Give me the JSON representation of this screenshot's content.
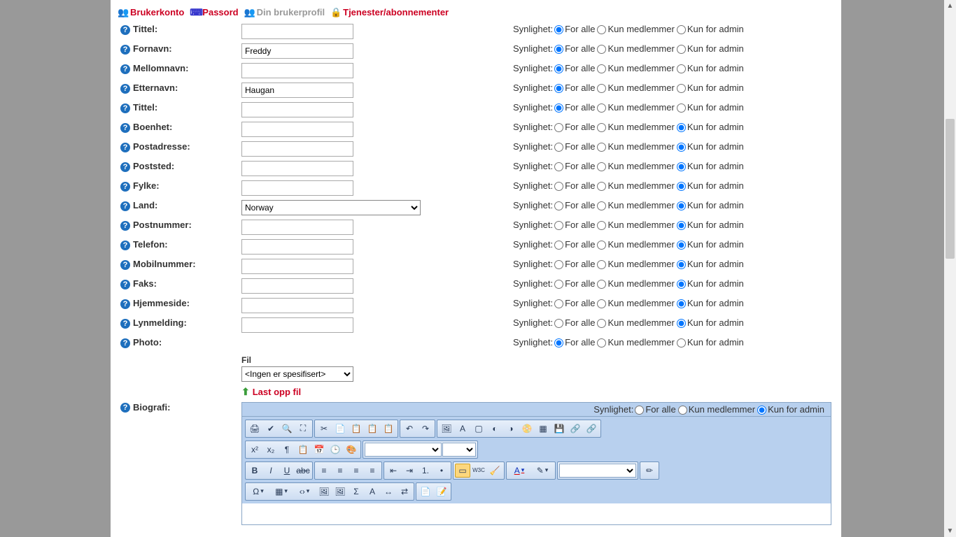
{
  "tabs": [
    {
      "label": "Brukerkonto",
      "active": true,
      "icon": "users"
    },
    {
      "label": "Passord",
      "active": true,
      "icon": "pass"
    },
    {
      "label": "Din brukerprofil",
      "active": false,
      "icon": "users"
    },
    {
      "label": "Tjenester/abonnementer",
      "active": true,
      "icon": "lock"
    }
  ],
  "visibility": {
    "label": "Synlighet:",
    "options": [
      "For alle",
      "Kun medlemmer",
      "Kun for admin"
    ]
  },
  "fields": [
    {
      "key": "tittel",
      "label": "Tittel:",
      "value": "",
      "type": "text",
      "vsel": 0
    },
    {
      "key": "fornavn",
      "label": "Fornavn:",
      "value": "Freddy",
      "type": "text",
      "vsel": 0
    },
    {
      "key": "mellomnavn",
      "label": "Mellomnavn:",
      "value": "",
      "type": "text",
      "vsel": 0
    },
    {
      "key": "etternavn",
      "label": "Etternavn:",
      "value": "Haugan",
      "type": "text",
      "vsel": 0
    },
    {
      "key": "tittel2",
      "label": "Tittel:",
      "value": "",
      "type": "text",
      "vsel": 0
    },
    {
      "key": "boenhet",
      "label": "Boenhet:",
      "value": "",
      "type": "text",
      "vsel": 2
    },
    {
      "key": "postadresse",
      "label": "Postadresse:",
      "value": "",
      "type": "text",
      "vsel": 2
    },
    {
      "key": "poststed",
      "label": "Poststed:",
      "value": "",
      "type": "text",
      "vsel": 2
    },
    {
      "key": "fylke",
      "label": "Fylke:",
      "value": "",
      "type": "text",
      "vsel": 2
    },
    {
      "key": "land",
      "label": "Land:",
      "value": "Norway",
      "type": "select",
      "vsel": 2
    },
    {
      "key": "postnummer",
      "label": "Postnummer:",
      "value": "",
      "type": "text",
      "vsel": 2
    },
    {
      "key": "telefon",
      "label": "Telefon:",
      "value": "",
      "type": "text",
      "vsel": 2
    },
    {
      "key": "mobilnummer",
      "label": "Mobilnummer:",
      "value": "",
      "type": "text",
      "vsel": 2
    },
    {
      "key": "faks",
      "label": "Faks:",
      "value": "",
      "type": "text",
      "vsel": 2
    },
    {
      "key": "hjemmeside",
      "label": "Hjemmeside:",
      "value": "",
      "type": "text",
      "vsel": 2
    },
    {
      "key": "lynmelding",
      "label": "Lynmelding:",
      "value": "",
      "type": "text",
      "vsel": 2
    },
    {
      "key": "photo",
      "label": "Photo:",
      "value": "",
      "type": "photo",
      "vsel": 0
    }
  ],
  "photo": {
    "fil_label": "Fil",
    "select_value": "<Ingen er spesifisert>",
    "upload_label": "Last opp fil"
  },
  "biografiRow": {
    "label": "Biografi:",
    "vsel": 2
  },
  "rte": {
    "row1": [
      [
        "print",
        "spell",
        "find",
        "fullscreen"
      ],
      [
        "cut",
        "copy",
        "paste",
        "paste-text",
        "paste-word"
      ],
      [
        "undo",
        "redo"
      ],
      [
        "image",
        "image-map",
        "char",
        "media1",
        "media2",
        "media3",
        "table-img",
        "anchor",
        "link",
        "unlink"
      ]
    ],
    "row2": [
      [
        "sup",
        "sub",
        "showblocks",
        "blockquote",
        "date",
        "time",
        "img-btn"
      ],
      [
        "select-font",
        "select-size"
      ]
    ],
    "row3": [
      [
        "bold",
        "italic",
        "underline",
        "strike"
      ],
      [
        "align-l",
        "align-c",
        "align-r",
        "align-j"
      ],
      [
        "outdent",
        "indent",
        "ol",
        "ul"
      ],
      [
        "div",
        "w3c",
        "clear"
      ],
      [
        "fontcolor",
        "bgcolor"
      ],
      [
        "select-style"
      ],
      [
        "highlight"
      ]
    ],
    "row4": [
      [
        "omega",
        "table",
        "brackets",
        "img-a",
        "img-b",
        "sigma",
        "find-a",
        "spacer",
        "replace"
      ],
      [
        "page",
        "page-ed"
      ]
    ],
    "glyphs": {
      "print": "🖨",
      "spell": "✔",
      "find": "🔍",
      "fullscreen": "⛶",
      "cut": "✂",
      "copy": "📄",
      "paste": "📋",
      "paste-text": "📋",
      "paste-word": "📋",
      "undo": "↶",
      "redo": "↷",
      "image": "🖼",
      "image-map": "A",
      "char": "▢",
      "media1": "◐",
      "media2": "◑",
      "media3": "📀",
      "table-img": "▦",
      "anchor": "💾",
      "link": "🔗",
      "unlink": "🔗",
      "sup": "x²",
      "sub": "x₂",
      "showblocks": "¶",
      "blockquote": "📋",
      "date": "📅",
      "time": "🕒",
      "img-btn": "🎨",
      "bold": "B",
      "italic": "I",
      "underline": "U",
      "strike": "abc",
      "align-l": "≡",
      "align-c": "≡",
      "align-r": "≡",
      "align-j": "≡",
      "outdent": "⇤",
      "indent": "⇥",
      "ol": "1.",
      "ul": "•",
      "div": "▭",
      "w3c": "W3C",
      "clear": "🧹",
      "fontcolor": "A",
      "bgcolor": "✎",
      "highlight": "✏",
      "omega": "Ω",
      "table": "▦",
      "brackets": "‹›",
      "img-a": "🖼",
      "img-b": "🖼",
      "sigma": "Σ",
      "find-a": "A",
      "spacer": "↔",
      "replace": "⇄",
      "page": "📄",
      "page-ed": "📝"
    },
    "dropdown_keys": [
      "table",
      "brackets",
      "fontcolor",
      "bgcolor",
      "omega"
    ]
  }
}
